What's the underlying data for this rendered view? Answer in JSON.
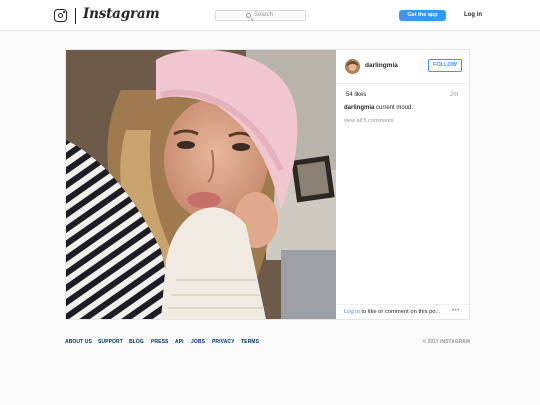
{
  "header": {
    "wordmark": "Instagram",
    "search_placeholder": "Search",
    "get_app_label": "Get the app",
    "login_label": "Log in"
  },
  "post": {
    "username": "darlingmia",
    "follow_label": "FOLLOW",
    "likes": "54 likes",
    "time_ago": "2m",
    "caption_user": "darlingmia",
    "caption_text": "current mood.",
    "view_comments": "view all 5 comments",
    "login_link": "Log in",
    "login_rest": "to like or comment on this po...",
    "more": "•••"
  },
  "footer": {
    "links": [
      "ABOUT US",
      "SUPPORT",
      "BLOG",
      "PRESS",
      "API",
      "JOBS",
      "PRIVACY",
      "TERMS"
    ],
    "copyright": "© 2017 INSTAGRAM"
  },
  "colors": {
    "accent": "#3897f0",
    "footer_link": "#003569",
    "background": "#fafafa"
  }
}
